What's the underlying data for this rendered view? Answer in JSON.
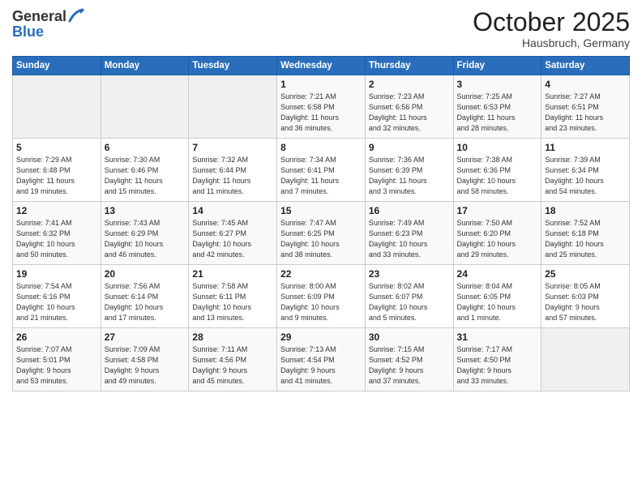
{
  "header": {
    "logo_general": "General",
    "logo_blue": "Blue",
    "month": "October 2025",
    "location": "Hausbruch, Germany"
  },
  "days_of_week": [
    "Sunday",
    "Monday",
    "Tuesday",
    "Wednesday",
    "Thursday",
    "Friday",
    "Saturday"
  ],
  "weeks": [
    {
      "days": [
        {
          "num": "",
          "info": ""
        },
        {
          "num": "",
          "info": ""
        },
        {
          "num": "",
          "info": ""
        },
        {
          "num": "1",
          "info": "Sunrise: 7:21 AM\nSunset: 6:58 PM\nDaylight: 11 hours\nand 36 minutes."
        },
        {
          "num": "2",
          "info": "Sunrise: 7:23 AM\nSunset: 6:56 PM\nDaylight: 11 hours\nand 32 minutes."
        },
        {
          "num": "3",
          "info": "Sunrise: 7:25 AM\nSunset: 6:53 PM\nDaylight: 11 hours\nand 28 minutes."
        },
        {
          "num": "4",
          "info": "Sunrise: 7:27 AM\nSunset: 6:51 PM\nDaylight: 11 hours\nand 23 minutes."
        }
      ]
    },
    {
      "days": [
        {
          "num": "5",
          "info": "Sunrise: 7:29 AM\nSunset: 6:48 PM\nDaylight: 11 hours\nand 19 minutes."
        },
        {
          "num": "6",
          "info": "Sunrise: 7:30 AM\nSunset: 6:46 PM\nDaylight: 11 hours\nand 15 minutes."
        },
        {
          "num": "7",
          "info": "Sunrise: 7:32 AM\nSunset: 6:44 PM\nDaylight: 11 hours\nand 11 minutes."
        },
        {
          "num": "8",
          "info": "Sunrise: 7:34 AM\nSunset: 6:41 PM\nDaylight: 11 hours\nand 7 minutes."
        },
        {
          "num": "9",
          "info": "Sunrise: 7:36 AM\nSunset: 6:39 PM\nDaylight: 11 hours\nand 3 minutes."
        },
        {
          "num": "10",
          "info": "Sunrise: 7:38 AM\nSunset: 6:36 PM\nDaylight: 10 hours\nand 58 minutes."
        },
        {
          "num": "11",
          "info": "Sunrise: 7:39 AM\nSunset: 6:34 PM\nDaylight: 10 hours\nand 54 minutes."
        }
      ]
    },
    {
      "days": [
        {
          "num": "12",
          "info": "Sunrise: 7:41 AM\nSunset: 6:32 PM\nDaylight: 10 hours\nand 50 minutes."
        },
        {
          "num": "13",
          "info": "Sunrise: 7:43 AM\nSunset: 6:29 PM\nDaylight: 10 hours\nand 46 minutes."
        },
        {
          "num": "14",
          "info": "Sunrise: 7:45 AM\nSunset: 6:27 PM\nDaylight: 10 hours\nand 42 minutes."
        },
        {
          "num": "15",
          "info": "Sunrise: 7:47 AM\nSunset: 6:25 PM\nDaylight: 10 hours\nand 38 minutes."
        },
        {
          "num": "16",
          "info": "Sunrise: 7:49 AM\nSunset: 6:23 PM\nDaylight: 10 hours\nand 33 minutes."
        },
        {
          "num": "17",
          "info": "Sunrise: 7:50 AM\nSunset: 6:20 PM\nDaylight: 10 hours\nand 29 minutes."
        },
        {
          "num": "18",
          "info": "Sunrise: 7:52 AM\nSunset: 6:18 PM\nDaylight: 10 hours\nand 25 minutes."
        }
      ]
    },
    {
      "days": [
        {
          "num": "19",
          "info": "Sunrise: 7:54 AM\nSunset: 6:16 PM\nDaylight: 10 hours\nand 21 minutes."
        },
        {
          "num": "20",
          "info": "Sunrise: 7:56 AM\nSunset: 6:14 PM\nDaylight: 10 hours\nand 17 minutes."
        },
        {
          "num": "21",
          "info": "Sunrise: 7:58 AM\nSunset: 6:11 PM\nDaylight: 10 hours\nand 13 minutes."
        },
        {
          "num": "22",
          "info": "Sunrise: 8:00 AM\nSunset: 6:09 PM\nDaylight: 10 hours\nand 9 minutes."
        },
        {
          "num": "23",
          "info": "Sunrise: 8:02 AM\nSunset: 6:07 PM\nDaylight: 10 hours\nand 5 minutes."
        },
        {
          "num": "24",
          "info": "Sunrise: 8:04 AM\nSunset: 6:05 PM\nDaylight: 10 hours\nand 1 minute."
        },
        {
          "num": "25",
          "info": "Sunrise: 8:05 AM\nSunset: 6:03 PM\nDaylight: 9 hours\nand 57 minutes."
        }
      ]
    },
    {
      "days": [
        {
          "num": "26",
          "info": "Sunrise: 7:07 AM\nSunset: 5:01 PM\nDaylight: 9 hours\nand 53 minutes."
        },
        {
          "num": "27",
          "info": "Sunrise: 7:09 AM\nSunset: 4:58 PM\nDaylight: 9 hours\nand 49 minutes."
        },
        {
          "num": "28",
          "info": "Sunrise: 7:11 AM\nSunset: 4:56 PM\nDaylight: 9 hours\nand 45 minutes."
        },
        {
          "num": "29",
          "info": "Sunrise: 7:13 AM\nSunset: 4:54 PM\nDaylight: 9 hours\nand 41 minutes."
        },
        {
          "num": "30",
          "info": "Sunrise: 7:15 AM\nSunset: 4:52 PM\nDaylight: 9 hours\nand 37 minutes."
        },
        {
          "num": "31",
          "info": "Sunrise: 7:17 AM\nSunset: 4:50 PM\nDaylight: 9 hours\nand 33 minutes."
        },
        {
          "num": "",
          "info": ""
        }
      ]
    }
  ]
}
